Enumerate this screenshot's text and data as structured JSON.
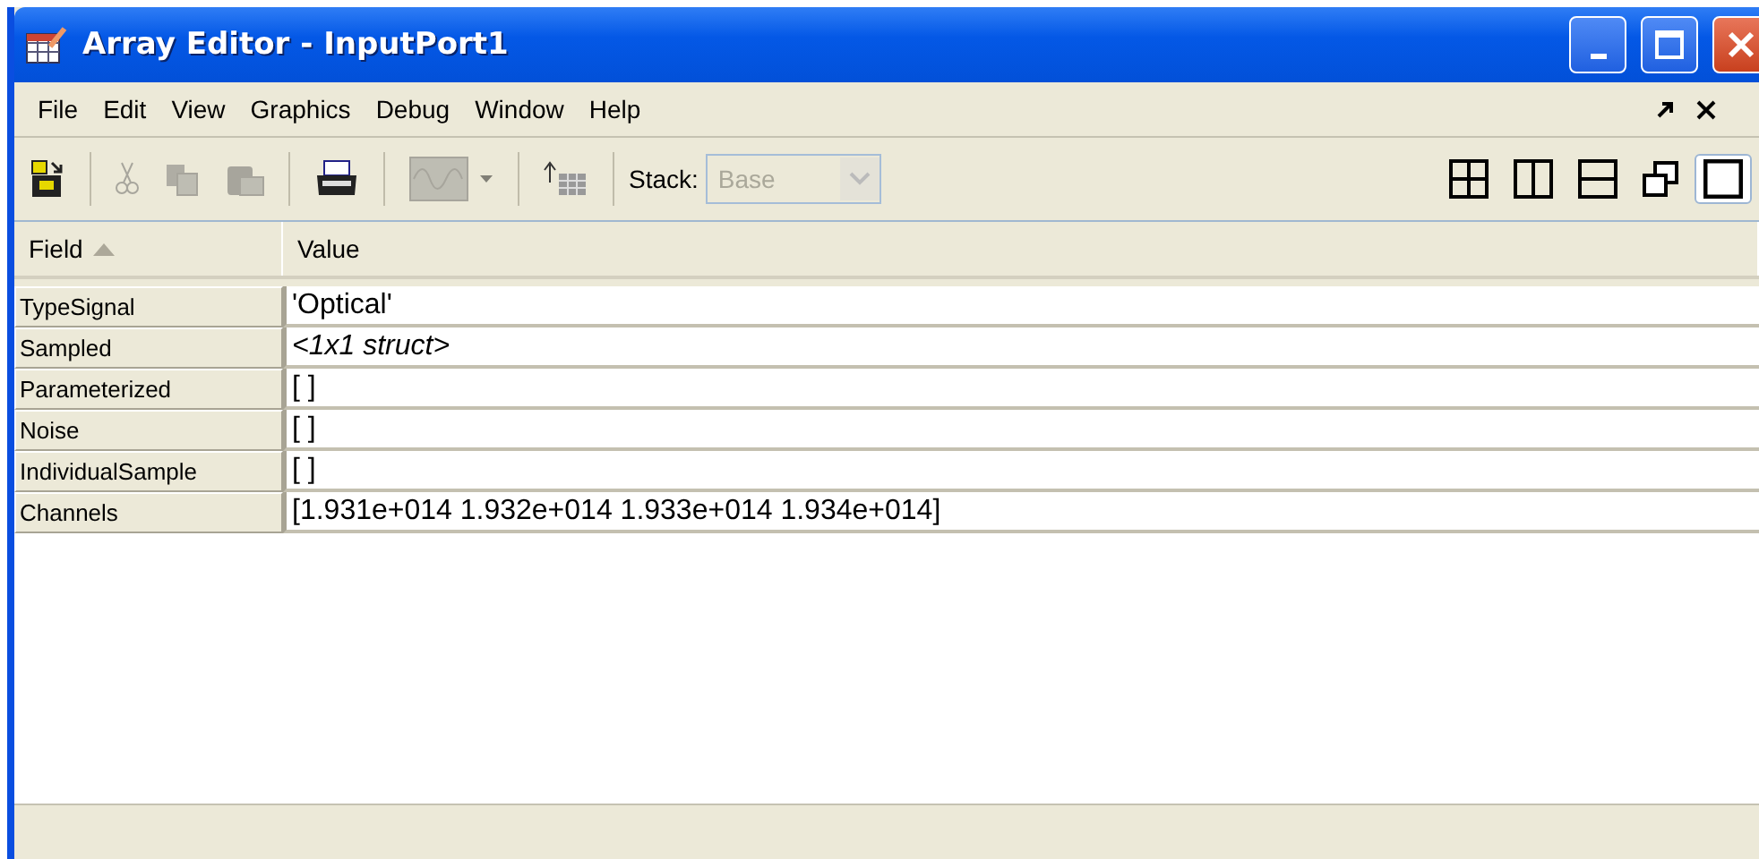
{
  "window": {
    "title": "Array Editor - InputPort1"
  },
  "menu": [
    "File",
    "Edit",
    "View",
    "Graphics",
    "Debug",
    "Window",
    "Help"
  ],
  "toolbar": {
    "tools": [
      {
        "kind": "import",
        "disabled": false
      },
      {
        "kind": "cut",
        "disabled": true
      },
      {
        "kind": "copy",
        "disabled": true
      },
      {
        "kind": "paste",
        "disabled": true
      },
      {
        "kind": "print",
        "disabled": false
      },
      {
        "kind": "plot",
        "disabled": true
      },
      {
        "kind": "lift",
        "disabled": false
      }
    ],
    "stack": {
      "label": "Stack:",
      "value": "Base",
      "disabled": true
    },
    "layouts": [
      {
        "kind": "grid",
        "selected": false
      },
      {
        "kind": "columns",
        "selected": false
      },
      {
        "kind": "rows",
        "selected": false
      },
      {
        "kind": "float",
        "selected": false
      },
      {
        "kind": "single",
        "selected": true
      }
    ]
  },
  "table": {
    "columns": [
      "Field",
      "Value"
    ],
    "rows": [
      {
        "field": "TypeSignal",
        "value": "'Optical'",
        "kind": "text"
      },
      {
        "field": "Sampled",
        "value": "<1x1 struct>",
        "kind": "struct"
      },
      {
        "field": "Parameterized",
        "value": "[ ]",
        "kind": "text"
      },
      {
        "field": "Noise",
        "value": "[ ]",
        "kind": "text"
      },
      {
        "field": "IndividualSample",
        "value": "[ ]",
        "kind": "text"
      },
      {
        "field": "Channels",
        "value": "[1.931e+014 1.932e+014 1.933e+014 1.934e+014]",
        "kind": "text"
      }
    ]
  }
}
